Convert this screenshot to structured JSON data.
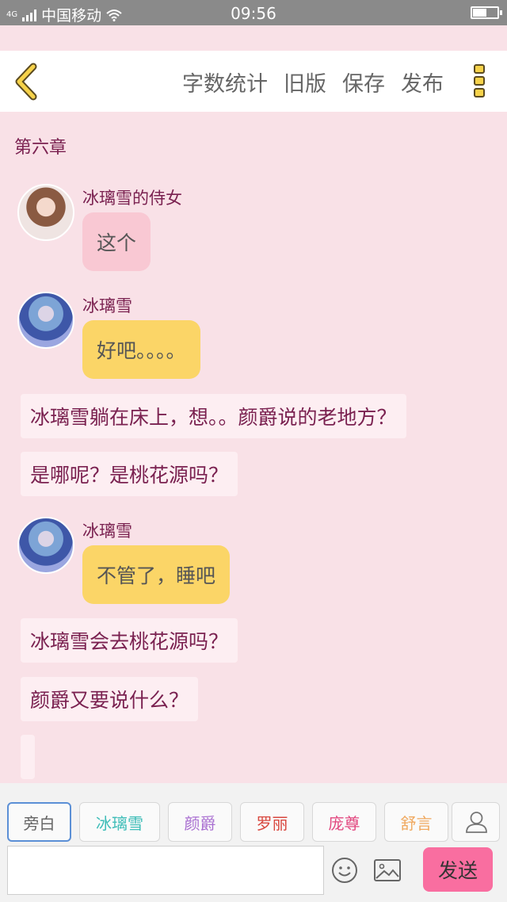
{
  "status": {
    "carrier_network": "4G",
    "carrier": "中国移动",
    "time": "09:56",
    "battery_level": 0.55
  },
  "header": {
    "actions": [
      "字数统计",
      "旧版",
      "保存",
      "发布"
    ],
    "accent": "#f6d24a"
  },
  "chapter": {
    "title": "第六章"
  },
  "messages": [
    {
      "sender": "冰璃雪的侍女",
      "text": "这个",
      "bubble_color": "#f9c8d3"
    },
    {
      "sender": "冰璃雪",
      "text": "好吧。。。。",
      "bubble_color": "#fbd567"
    },
    {
      "sender": "冰璃雪",
      "text": "不管了，睡吧",
      "bubble_color": "#fbd567"
    }
  ],
  "narrations": [
    "冰璃雪躺在床上，想。。颜爵说的老地方？",
    "是哪呢？是桃花源吗？",
    "冰璃雪会去桃花源吗？",
    "颜爵又要说什么？"
  ],
  "characters": [
    {
      "name": "旁白",
      "color": "#666666"
    },
    {
      "name": "冰璃雪",
      "color": "#3fbdb8"
    },
    {
      "name": "颜爵",
      "color": "#a96fd1"
    },
    {
      "name": "罗丽",
      "color": "#d8473e"
    },
    {
      "name": "庞尊",
      "color": "#e2477f"
    },
    {
      "name": "舒言",
      "color": "#f0a85e"
    }
  ],
  "input": {
    "value": "",
    "placeholder": ""
  },
  "send_label": "发送"
}
